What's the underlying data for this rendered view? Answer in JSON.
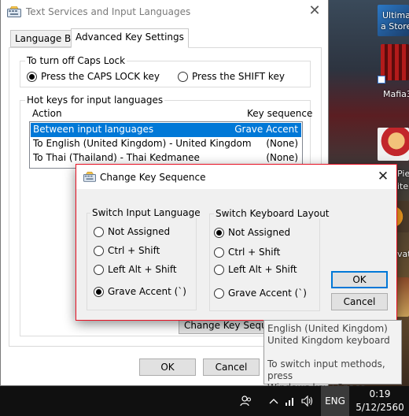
{
  "main_dialog": {
    "title": "Text Services and Input Languages",
    "tabs": [
      {
        "label": "Language Bar"
      },
      {
        "label": "Advanced Key Settings"
      }
    ],
    "caps_lock": {
      "group_label": "To turn off Caps Lock",
      "option_caps": "Press the CAPS LOCK key",
      "option_shift": "Press the SHIFT key",
      "selected": "caps"
    },
    "hot_keys": {
      "group_label": "Hot keys for input languages",
      "col_action": "Action",
      "col_sequence": "Key sequence",
      "rows": [
        {
          "action": "Between input languages",
          "sequence": "Grave Accent"
        },
        {
          "action": "To English (United Kingdom) - United Kingdom",
          "sequence": "(None)"
        },
        {
          "action": "To Thai (Thailand) - Thai Kedmanee",
          "sequence": "(None)"
        }
      ],
      "change_button": "Change Key Sequence..."
    },
    "ok_button": "OK",
    "cancel_button": "Cancel"
  },
  "change_key_dialog": {
    "title": "Change Key Sequence",
    "switch_input": {
      "label": "Switch Input Language",
      "options": [
        "Not Assigned",
        "Ctrl + Shift",
        "Left Alt + Shift",
        "Grave Accent (`)"
      ],
      "selected_index": 3
    },
    "switch_layout": {
      "label": "Switch Keyboard Layout",
      "options": [
        "Not Assigned",
        "Ctrl + Shift",
        "Left Alt + Shift",
        "Grave Accent (`)"
      ],
      "selected_index": 0
    },
    "ok_button": "OK",
    "cancel_button": "Cancel"
  },
  "tooltip": {
    "line1": "English (United Kingdom)",
    "line2": "United Kingdom keyboard",
    "line3": "To switch input methods, press",
    "line4": "Windows key+Space."
  },
  "desktop": {
    "label1a": "Ultimat",
    "label1b": "a Store",
    "label2": "Mafia3",
    "label3a": "Piec",
    "label3b": "ite",
    "label4": "vat"
  },
  "taskbar": {
    "language": "ENG",
    "time": "0:19",
    "date": "5/12/2560",
    "icons": [
      "people-icon",
      "chevron-up-icon",
      "network-icon",
      "volume-icon",
      "action-center-icon"
    ]
  }
}
